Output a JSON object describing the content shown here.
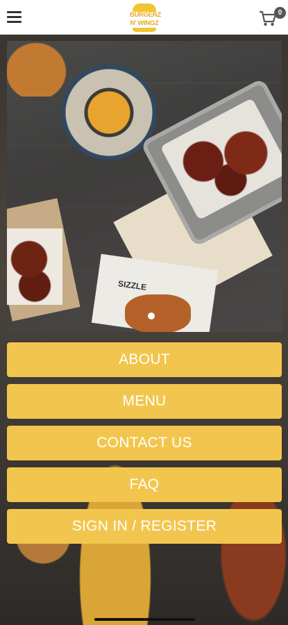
{
  "header": {
    "menu_icon": "hamburger-menu-icon",
    "logo_line1": "BURGERZ",
    "logo_line2": "N' WINGZ",
    "cart_icon": "shopping-cart-icon",
    "cart_count": "0"
  },
  "slider": {
    "paper_text": "SIZZLE",
    "active_dot": 1,
    "total_dots": 1
  },
  "menu": {
    "about": "ABOUT",
    "menu": "MENU",
    "contact": "CONTACT US",
    "faq": "FAQ",
    "signin": "SIGN IN / REGISTER"
  },
  "colors": {
    "button_bg": "#f2c64e",
    "button_text": "#ffffff",
    "brand_yellow": "#f2c530"
  }
}
